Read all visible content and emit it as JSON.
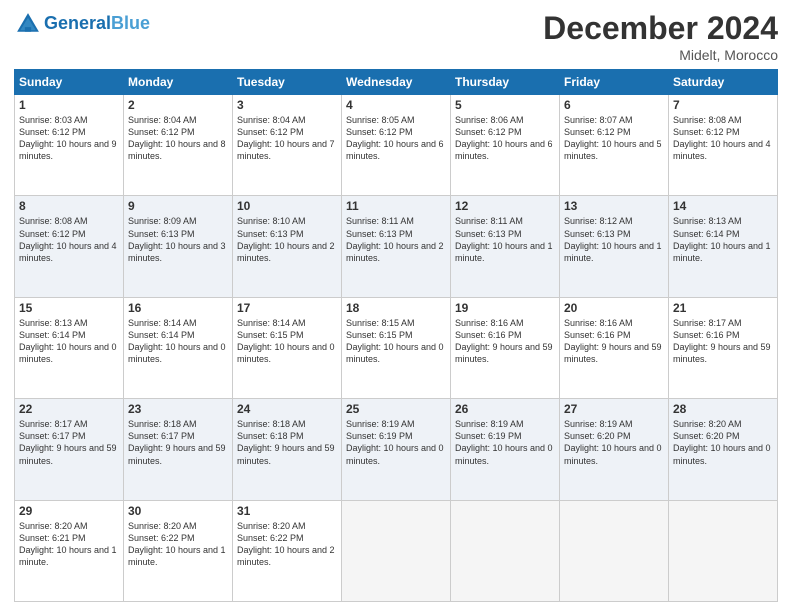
{
  "header": {
    "logo_line1": "General",
    "logo_line2": "Blue",
    "month_title": "December 2024",
    "location": "Midelt, Morocco"
  },
  "days_of_week": [
    "Sunday",
    "Monday",
    "Tuesday",
    "Wednesday",
    "Thursday",
    "Friday",
    "Saturday"
  ],
  "weeks": [
    [
      {
        "day": "1",
        "sunrise": "8:03 AM",
        "sunset": "6:12 PM",
        "daylight": "10 hours and 9 minutes."
      },
      {
        "day": "2",
        "sunrise": "8:04 AM",
        "sunset": "6:12 PM",
        "daylight": "10 hours and 8 minutes."
      },
      {
        "day": "3",
        "sunrise": "8:04 AM",
        "sunset": "6:12 PM",
        "daylight": "10 hours and 7 minutes."
      },
      {
        "day": "4",
        "sunrise": "8:05 AM",
        "sunset": "6:12 PM",
        "daylight": "10 hours and 6 minutes."
      },
      {
        "day": "5",
        "sunrise": "8:06 AM",
        "sunset": "6:12 PM",
        "daylight": "10 hours and 6 minutes."
      },
      {
        "day": "6",
        "sunrise": "8:07 AM",
        "sunset": "6:12 PM",
        "daylight": "10 hours and 5 minutes."
      },
      {
        "day": "7",
        "sunrise": "8:08 AM",
        "sunset": "6:12 PM",
        "daylight": "10 hours and 4 minutes."
      }
    ],
    [
      {
        "day": "8",
        "sunrise": "8:08 AM",
        "sunset": "6:12 PM",
        "daylight": "10 hours and 4 minutes."
      },
      {
        "day": "9",
        "sunrise": "8:09 AM",
        "sunset": "6:13 PM",
        "daylight": "10 hours and 3 minutes."
      },
      {
        "day": "10",
        "sunrise": "8:10 AM",
        "sunset": "6:13 PM",
        "daylight": "10 hours and 2 minutes."
      },
      {
        "day": "11",
        "sunrise": "8:11 AM",
        "sunset": "6:13 PM",
        "daylight": "10 hours and 2 minutes."
      },
      {
        "day": "12",
        "sunrise": "8:11 AM",
        "sunset": "6:13 PM",
        "daylight": "10 hours and 1 minute."
      },
      {
        "day": "13",
        "sunrise": "8:12 AM",
        "sunset": "6:13 PM",
        "daylight": "10 hours and 1 minute."
      },
      {
        "day": "14",
        "sunrise": "8:13 AM",
        "sunset": "6:14 PM",
        "daylight": "10 hours and 1 minute."
      }
    ],
    [
      {
        "day": "15",
        "sunrise": "8:13 AM",
        "sunset": "6:14 PM",
        "daylight": "10 hours and 0 minutes."
      },
      {
        "day": "16",
        "sunrise": "8:14 AM",
        "sunset": "6:14 PM",
        "daylight": "10 hours and 0 minutes."
      },
      {
        "day": "17",
        "sunrise": "8:14 AM",
        "sunset": "6:15 PM",
        "daylight": "10 hours and 0 minutes."
      },
      {
        "day": "18",
        "sunrise": "8:15 AM",
        "sunset": "6:15 PM",
        "daylight": "10 hours and 0 minutes."
      },
      {
        "day": "19",
        "sunrise": "8:16 AM",
        "sunset": "6:16 PM",
        "daylight": "9 hours and 59 minutes."
      },
      {
        "day": "20",
        "sunrise": "8:16 AM",
        "sunset": "6:16 PM",
        "daylight": "9 hours and 59 minutes."
      },
      {
        "day": "21",
        "sunrise": "8:17 AM",
        "sunset": "6:16 PM",
        "daylight": "9 hours and 59 minutes."
      }
    ],
    [
      {
        "day": "22",
        "sunrise": "8:17 AM",
        "sunset": "6:17 PM",
        "daylight": "9 hours and 59 minutes."
      },
      {
        "day": "23",
        "sunrise": "8:18 AM",
        "sunset": "6:17 PM",
        "daylight": "9 hours and 59 minutes."
      },
      {
        "day": "24",
        "sunrise": "8:18 AM",
        "sunset": "6:18 PM",
        "daylight": "9 hours and 59 minutes."
      },
      {
        "day": "25",
        "sunrise": "8:19 AM",
        "sunset": "6:19 PM",
        "daylight": "10 hours and 0 minutes."
      },
      {
        "day": "26",
        "sunrise": "8:19 AM",
        "sunset": "6:19 PM",
        "daylight": "10 hours and 0 minutes."
      },
      {
        "day": "27",
        "sunrise": "8:19 AM",
        "sunset": "6:20 PM",
        "daylight": "10 hours and 0 minutes."
      },
      {
        "day": "28",
        "sunrise": "8:20 AM",
        "sunset": "6:20 PM",
        "daylight": "10 hours and 0 minutes."
      }
    ],
    [
      {
        "day": "29",
        "sunrise": "8:20 AM",
        "sunset": "6:21 PM",
        "daylight": "10 hours and 1 minute."
      },
      {
        "day": "30",
        "sunrise": "8:20 AM",
        "sunset": "6:22 PM",
        "daylight": "10 hours and 1 minute."
      },
      {
        "day": "31",
        "sunrise": "8:20 AM",
        "sunset": "6:22 PM",
        "daylight": "10 hours and 2 minutes."
      },
      null,
      null,
      null,
      null
    ]
  ]
}
